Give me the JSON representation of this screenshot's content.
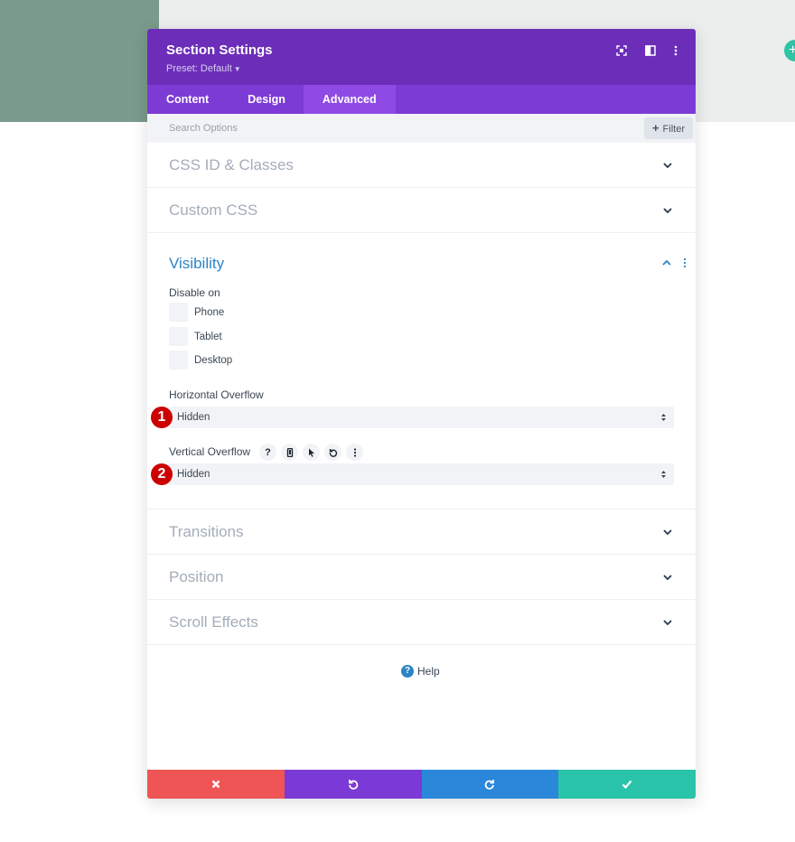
{
  "colors": {
    "header_bg": "#6c2eb9",
    "tabs_bg": "#7d3bd6",
    "tab_active_bg": "#8f4ae6",
    "accent_blue": "#2c84c6",
    "cancel": "#ef5555",
    "undo": "#7b3ad5",
    "redo": "#2b87da",
    "save": "#29c4a9",
    "marker": "#cc0000"
  },
  "modal": {
    "title": "Section Settings",
    "preset": "Preset: Default",
    "header_icons": [
      "expand-icon",
      "split-view-icon",
      "more-vertical-icon"
    ]
  },
  "tabs": [
    {
      "label": "Content",
      "active": false
    },
    {
      "label": "Design",
      "active": false
    },
    {
      "label": "Advanced",
      "active": true
    }
  ],
  "search": {
    "placeholder": "Search Options",
    "filter_label": "Filter"
  },
  "sections": {
    "css_id": "CSS ID & Classes",
    "custom_css": "Custom CSS",
    "visibility": "Visibility",
    "transitions": "Transitions",
    "position": "Position",
    "scroll_effects": "Scroll Effects"
  },
  "visibility": {
    "disable_on_label": "Disable on",
    "options": [
      {
        "label": "Phone",
        "checked": false
      },
      {
        "label": "Tablet",
        "checked": false
      },
      {
        "label": "Desktop",
        "checked": false
      }
    ],
    "horizontal_overflow": {
      "label": "Horizontal Overflow",
      "value": "Hidden",
      "marker": "1"
    },
    "vertical_overflow": {
      "label": "Vertical Overflow",
      "value": "Hidden",
      "marker": "2",
      "icons": [
        "help-icon",
        "mobile-icon",
        "cursor-icon",
        "reset-icon",
        "more-vertical-icon"
      ]
    }
  },
  "help": {
    "label": "Help"
  },
  "footer": {
    "buttons": [
      "cancel-icon",
      "undo-icon",
      "redo-icon",
      "check-icon"
    ]
  }
}
